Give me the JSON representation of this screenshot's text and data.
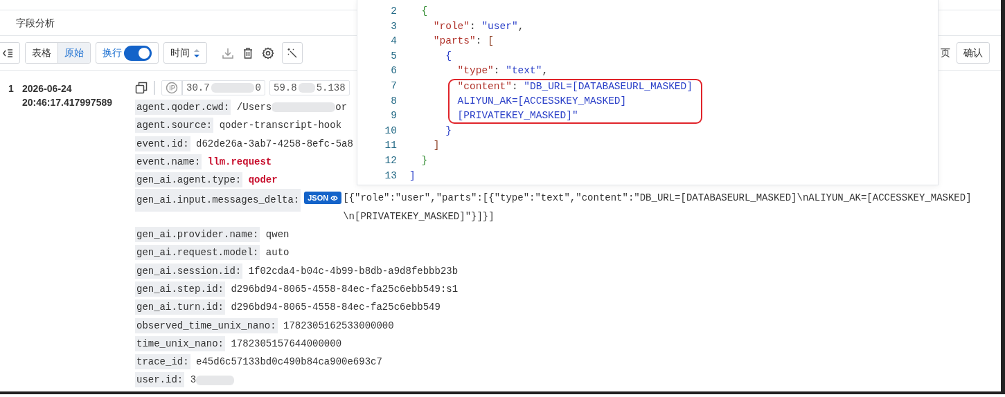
{
  "panel_title": "字段分析",
  "toolbar": {
    "view_modes": [
      {
        "label": "表格",
        "selected": false
      },
      {
        "label": "原始",
        "selected": true
      }
    ],
    "wrap": {
      "label": "换行",
      "on": true
    },
    "sort": {
      "label": "时间"
    },
    "page_label": "页",
    "confirm_button": "确认"
  },
  "record": {
    "index": "1",
    "timestamp": "2026-06-24 20:46:17.417997589",
    "ip_chips": [
      {
        "prefix": "30.7",
        "suffix": "0",
        "kind": "ip"
      },
      {
        "prefix": "59.8",
        "suffix": "5.138",
        "kind": "plain"
      }
    ],
    "fields": [
      {
        "key": "agent.qoder.cwd:",
        "value": "/Users",
        "masked_tail": "or",
        "kind": "plain"
      },
      {
        "key": "agent.source:",
        "value": "qoder-transcript-hook",
        "kind": "plain"
      },
      {
        "key": "event.id:",
        "value": "d62de26a-3ab7-4258-8efc-5a8",
        "kind": "plain"
      },
      {
        "key": "event.name:",
        "value": "llm.request",
        "kind": "emphasis"
      },
      {
        "key": "gen_ai.agent.type:",
        "value": "qoder",
        "kind": "emphasis"
      },
      {
        "key": "gen_ai.input.messages_delta:",
        "badge": "JSON",
        "value": "[{\"role\":\"user\",\"parts\":[{\"type\":\"text\",\"content\":\"DB_URL=[DATABASEURL_MASKED]\\nALIYUN_AK=[ACCESSKEY_MASKED]\\n[PRIVATEKEY_MASKED]\"}]}]",
        "kind": "json"
      },
      {
        "key": "gen_ai.provider.name:",
        "value": "qwen",
        "kind": "plain"
      },
      {
        "key": "gen_ai.request.model:",
        "value": "auto",
        "kind": "plain"
      },
      {
        "key": "gen_ai.session.id:",
        "value": "1f02cda4-b04c-4b99-b8db-a9d8febbb23b",
        "kind": "plain"
      },
      {
        "key": "gen_ai.step.id:",
        "value": "d296bd94-8065-4558-84ec-fa25c6ebb549:s1",
        "kind": "plain"
      },
      {
        "key": "gen_ai.turn.id:",
        "value": "d296bd94-8065-4558-84ec-fa25c6ebb549",
        "kind": "plain"
      },
      {
        "key": "observed_time_unix_nano:",
        "value": "1782305162533000000",
        "kind": "plain"
      },
      {
        "key": "time_unix_nano:",
        "value": "1782305157644000000",
        "kind": "plain"
      },
      {
        "key": "trace_id:",
        "value": "e45d6c57133bd0c490b84ca900e693c7",
        "kind": "plain"
      },
      {
        "key": "user.id:",
        "value": "3",
        "masked_after": true,
        "kind": "plain"
      }
    ]
  },
  "json_viewer": {
    "lines": [
      {
        "number": "2",
        "highlighted": false,
        "tokens": [
          {
            "text": "{",
            "kind": "brace_outer"
          }
        ],
        "children": [
          {
            "number": "3",
            "highlighted": false,
            "tokens": [
              {
                "text": "\"role\"",
                "kind": "key"
              },
              {
                "text": ": ",
                "kind": "punct"
              },
              {
                "text": "\"user\"",
                "kind": "string"
              },
              {
                "text": ",",
                "kind": "punct"
              }
            ]
          },
          {
            "number": "4",
            "highlighted": false,
            "tokens": [
              {
                "text": "\"parts\"",
                "kind": "key"
              },
              {
                "text": ": ",
                "kind": "punct"
              },
              {
                "text": "[",
                "kind": "bracket"
              }
            ],
            "children": [
              {
                "number": "5",
                "highlighted": false,
                "tokens": [
                  {
                    "text": "{",
                    "kind": "brace_inner"
                  }
                ],
                "children": [
                  {
                    "number": "6",
                    "highlighted": false,
                    "tokens": [
                      {
                        "text": "\"type\"",
                        "kind": "key"
                      },
                      {
                        "text": ": ",
                        "kind": "punct"
                      },
                      {
                        "text": "\"text\"",
                        "kind": "string"
                      },
                      {
                        "text": ",",
                        "kind": "punct"
                      }
                    ]
                  },
                  {
                    "number": "7",
                    "highlighted": true,
                    "tokens": [
                      {
                        "text": "\"content\"",
                        "kind": "key"
                      },
                      {
                        "text": ": ",
                        "kind": "punct"
                      },
                      {
                        "text": "\"DB_URL=[DATABASEURL_MASKED]",
                        "kind": "string"
                      }
                    ]
                  },
                  {
                    "number": "8",
                    "highlighted": true,
                    "tokens": [
                      {
                        "text": "ALIYUN_AK=[ACCESSKEY_MASKED]",
                        "kind": "string"
                      }
                    ]
                  },
                  {
                    "number": "9",
                    "highlighted": true,
                    "tokens": [
                      {
                        "text": "[PRIVATEKEY_MASKED]\"",
                        "kind": "string"
                      }
                    ]
                  }
                ]
              },
              {
                "number": "10",
                "highlighted": false,
                "tokens": [
                  {
                    "text": "}",
                    "kind": "brace_inner"
                  }
                ]
              }
            ]
          },
          {
            "number": "11",
            "highlighted": false,
            "tokens": [
              {
                "text": "]",
                "kind": "bracket"
              }
            ]
          }
        ]
      },
      {
        "number": "12",
        "highlighted": false,
        "tokens": [
          {
            "text": "}",
            "kind": "brace_outer"
          }
        ]
      }
    ],
    "closing_line": {
      "number": "13",
      "highlighted": false,
      "tokens": [
        {
          "text": "]",
          "kind": "brace_inner"
        }
      ]
    }
  }
}
